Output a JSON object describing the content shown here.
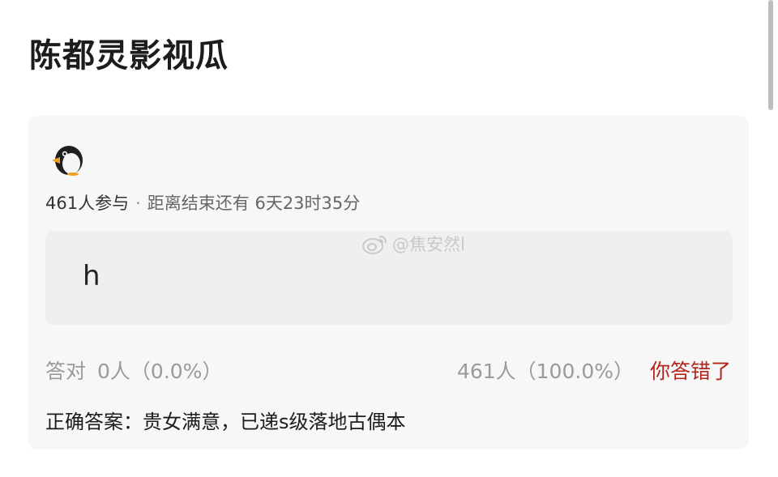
{
  "page": {
    "title": "陈都灵影视瓜"
  },
  "poll": {
    "avatar_icon": "penguin-icon",
    "participants": "461人参与",
    "separator": "·",
    "time_left": "距离结束还有 6天23时35分",
    "option_text": "h",
    "watermark": "@焦安然l",
    "correct_label": "答对",
    "correct_count": "0人（0.0%）",
    "other_count": "461人（100.0%）",
    "result": "你答错了",
    "answer": "正确答案：贵女满意，已递s级落地古偶本"
  },
  "colors": {
    "card_bg": "#f7f7f7",
    "option_bg": "#efefef",
    "wrong_red": "#b3261e",
    "muted_gray": "#9a9a9a"
  }
}
